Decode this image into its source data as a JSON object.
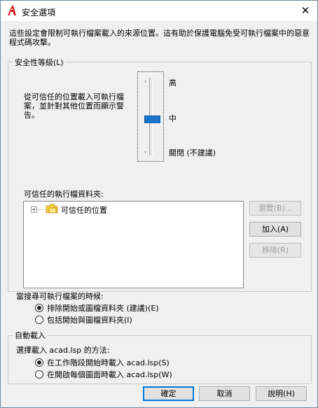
{
  "window": {
    "title": "安全選項",
    "close_glyph": "✕"
  },
  "description": "這些設定會限制可執行檔案載入的來源位置。這有助於保護電腦免受可執行檔案中的惡意程式碼攻擊。",
  "security_level": {
    "group_label": "安全性等級(L)",
    "explanation": "從可信任的位置載入可執行檔案，並針對其他位置而顯示警告。",
    "levels": {
      "high": "高",
      "medium": "中",
      "off": "關閉 (不建議)"
    },
    "selected": "中",
    "trusted_folders_label": "可信任的執行檔資料夾:",
    "tree_item": "可信任的位置",
    "buttons": {
      "browse": "瀏覽(B)...",
      "add": "加入(A)",
      "remove": "移除(R)"
    }
  },
  "search_option": {
    "label": "當搜尋可執行檔案的時候:",
    "options": [
      "排除開始或圖檔資料夾 (建議)(E)",
      "包括開始與圖檔資料夾(I)"
    ],
    "selected_index": 0
  },
  "autoload": {
    "group_label": "自動載入",
    "method_label": "選擇載入 acad.lsp 的方法:",
    "options": [
      "在工作階段開始時載入 acad.lsp(S)",
      "在開啟每個圖面時載入 acad.lsp(W)"
    ],
    "selected_index": 0
  },
  "footer": {
    "ok": "確定",
    "cancel": "取消",
    "help": "說明(H)"
  },
  "colors": {
    "accent": "#1a73c9",
    "app_icon": "#d42020"
  },
  "icons": {
    "app": "autocad-logo-icon",
    "folder": "trusted-folder-icon",
    "expander": "tree-expand-icon"
  }
}
